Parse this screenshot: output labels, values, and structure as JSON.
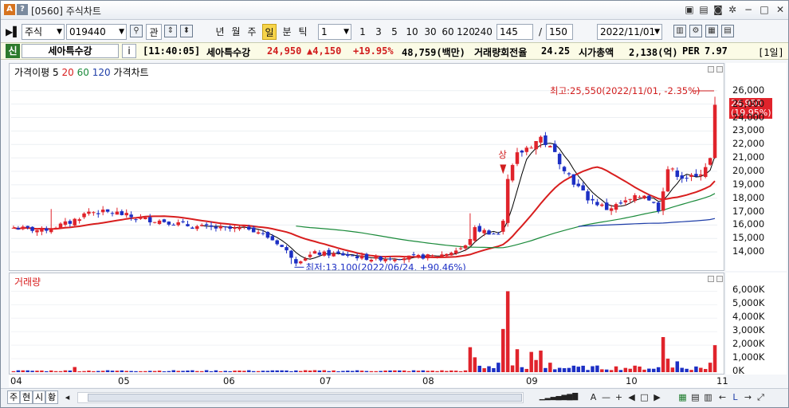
{
  "window": {
    "title": "[0560] 주식차트",
    "badge_a": "A",
    "badge_q": "?",
    "controls": [
      "minimize",
      "maximize",
      "close"
    ]
  },
  "toolbar": {
    "market": "주식",
    "code": "019440",
    "btn_related": "관",
    "periods": [
      "년",
      "월",
      "주",
      "일",
      "분",
      "틱"
    ],
    "active_period": "일",
    "interval_value": "1",
    "quick_intervals": [
      "1",
      "3",
      "5",
      "10",
      "30",
      "60",
      "120",
      "240"
    ],
    "count_view": "145",
    "count_separator": "/",
    "count_total": "150",
    "date": "2022/11/01"
  },
  "quote": {
    "new_badge": "신",
    "name": "세아특수강",
    "info_btn": "i",
    "time": "[11:40:05]",
    "name_inline": "세아특수강",
    "price": "24,950",
    "change": "▲4,150",
    "change_pct": "+19.95%",
    "trade_value": "48,759(백만)",
    "turnover_label": "거래량회전율",
    "turnover": "24.25",
    "mcap_label": "시가총액",
    "mcap": "2,138(억)",
    "per_label": "PER",
    "per": "7.97",
    "day_label": "[1일]"
  },
  "colors": {
    "up": "#e0232b",
    "down": "#1c2fc4",
    "ma5": "#000000",
    "ma20": "#d81e1e",
    "ma60": "#1a8a3a",
    "ma120": "#1f3ea8"
  },
  "chart_data": [
    {
      "type": "candlestick",
      "title": "가격차트",
      "legend": [
        "가격이평",
        "5",
        "20",
        "60",
        "120",
        "가격차트"
      ],
      "ylim": [
        13000,
        26700
      ],
      "y_ticks": [
        14000,
        15000,
        16000,
        17000,
        18000,
        19000,
        20000,
        21000,
        22000,
        23000,
        24000,
        25000,
        26000
      ],
      "y_tick_labels": [
        "14,000",
        "15,000",
        "16,000",
        "17,000",
        "18,000",
        "19,000",
        "20,000",
        "21,000",
        "22,000",
        "23,000",
        "24,000",
        "25,000",
        "26,000"
      ],
      "x_labels": [
        "04",
        "05",
        "06",
        "07",
        "08",
        "09",
        "10",
        "11"
      ],
      "high_note": "최고:25,550(2022/11/01, -2.35%)",
      "low_note": "최저:13,100(2022/06/24, +90.46%)",
      "limit_up_mark": "상",
      "last_price_label": "24,950",
      "last_pct_label": "(19.95%)",
      "last_price": 24950,
      "key_points": [
        {
          "date": "2022/04",
          "close": 15800
        },
        {
          "date": "2022/04 end",
          "close": 17000
        },
        {
          "date": "2022/05",
          "close": 16500
        },
        {
          "date": "2022/06 start",
          "close": 15700
        },
        {
          "date": "2022/06/24",
          "low": 13100
        },
        {
          "date": "2022/07",
          "close": 13900
        },
        {
          "date": "2022/08",
          "close": 13700
        },
        {
          "date": "2022/08 end",
          "close": 15500
        },
        {
          "date": "2022/09 start",
          "close": 21500
        },
        {
          "date": "2022/09 mid",
          "high": 22800
        },
        {
          "date": "2022/10 start",
          "close": 17200
        },
        {
          "date": "2022/10 end",
          "close": 19800
        },
        {
          "date": "2022/11/01",
          "close": 24950,
          "high": 25550
        }
      ]
    },
    {
      "type": "bar",
      "title": "거래량",
      "legend": [
        "거래량"
      ],
      "ylim": [
        0,
        6500000
      ],
      "y_ticks": [
        0,
        1000000,
        2000000,
        3000000,
        4000000,
        5000000,
        6000000
      ],
      "y_tick_labels": [
        "0K",
        "1,000K",
        "2,000K",
        "3,000K",
        "4,000K",
        "5,000K",
        "6,000K"
      ],
      "notable_bars": [
        {
          "period": "08 late",
          "volume": 1850000
        },
        {
          "period": "09 start",
          "volume": 3200000
        },
        {
          "period": "09 start peak",
          "volume": 6000000
        },
        {
          "period": "09 second",
          "volume": 1700000
        },
        {
          "period": "10 late",
          "volume": 2600000
        },
        {
          "period": "11/01",
          "volume": 2000000
        }
      ]
    }
  ],
  "bottombar": {
    "tabs": [
      "주",
      "현",
      "시",
      "황"
    ],
    "tools": [
      "A",
      "—",
      "+",
      "□",
      "▶"
    ]
  }
}
